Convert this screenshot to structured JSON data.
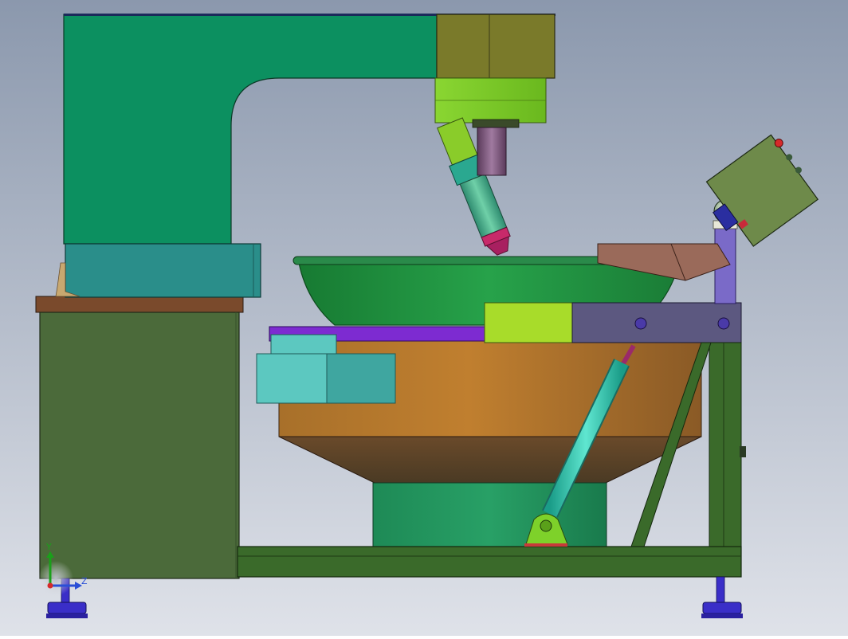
{
  "viewport": {
    "background_top": "#8b98ad",
    "background_bottom": "#dfe2e9"
  },
  "triad": {
    "y_label": "Y",
    "z_label": "Z",
    "y_color": "#1aa01a",
    "z_color": "#2a4fd6",
    "x_color": "#d62a2a"
  },
  "colors": {
    "frame_green": "#0c9060",
    "cabinet_olive": "#4b6a3a",
    "bowl_green": "#1c8a3c",
    "copper": "#b67a2c",
    "teal": "#3aa6a0",
    "lime": "#7ed12a",
    "purple": "#7d2bd1",
    "slate_plate": "#5c5880",
    "cylinder_cyan": "#38d0b8",
    "foot_blue": "#3a2ec8",
    "control_panel": "#6e8a4a"
  },
  "parts": [
    "press-frame",
    "press-head",
    "lime-coupler",
    "spindle",
    "angled-nozzle",
    "mixing-bowl",
    "base-cabinet",
    "bowl-drum",
    "tilt-cylinder",
    "side-frame",
    "control-panel",
    "leveling-feet"
  ]
}
